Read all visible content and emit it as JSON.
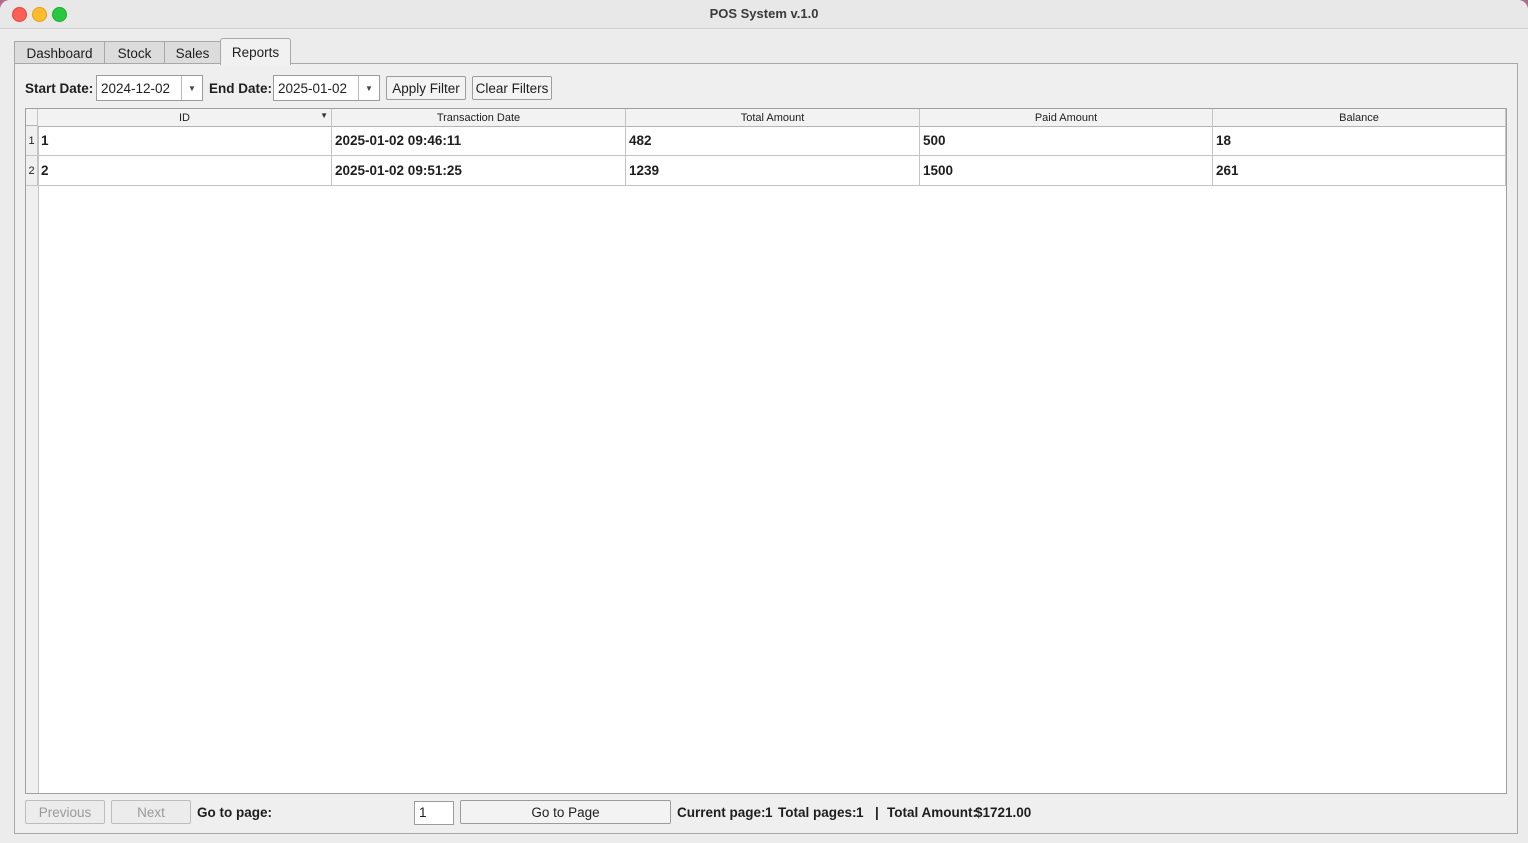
{
  "window": {
    "title": "POS System v.1.0"
  },
  "tabs": [
    {
      "label": "Dashboard"
    },
    {
      "label": "Stock"
    },
    {
      "label": "Sales"
    },
    {
      "label": "Reports",
      "active": true
    }
  ],
  "filters": {
    "start_label": "Start Date:",
    "start_value": "2024-12-02",
    "end_label": "End Date:",
    "end_value": "2025-01-02",
    "apply_label": "Apply Filter",
    "clear_label": "Clear Filters"
  },
  "table": {
    "columns": [
      "ID",
      "Transaction Date",
      "Total Amount",
      "Paid Amount",
      "Balance"
    ],
    "rows": [
      {
        "num": "1",
        "cells": [
          "1",
          "2025-01-02 09:46:11",
          "482",
          "500",
          "18"
        ]
      },
      {
        "num": "2",
        "cells": [
          "2",
          "2025-01-02 09:51:25",
          "1239",
          "1500",
          "261"
        ]
      }
    ]
  },
  "pagination": {
    "previous_label": "Previous",
    "next_label": "Next",
    "goto_label": "Go to page:",
    "page_input_value": "1",
    "goto_button_label": "Go to Page",
    "current_page_label": "Current page:",
    "current_page": "1",
    "total_pages_label": "Total pages:",
    "total_pages": "1",
    "separator": "|",
    "total_amount_label": "Total Amount:",
    "total_amount": "$1721.00"
  }
}
